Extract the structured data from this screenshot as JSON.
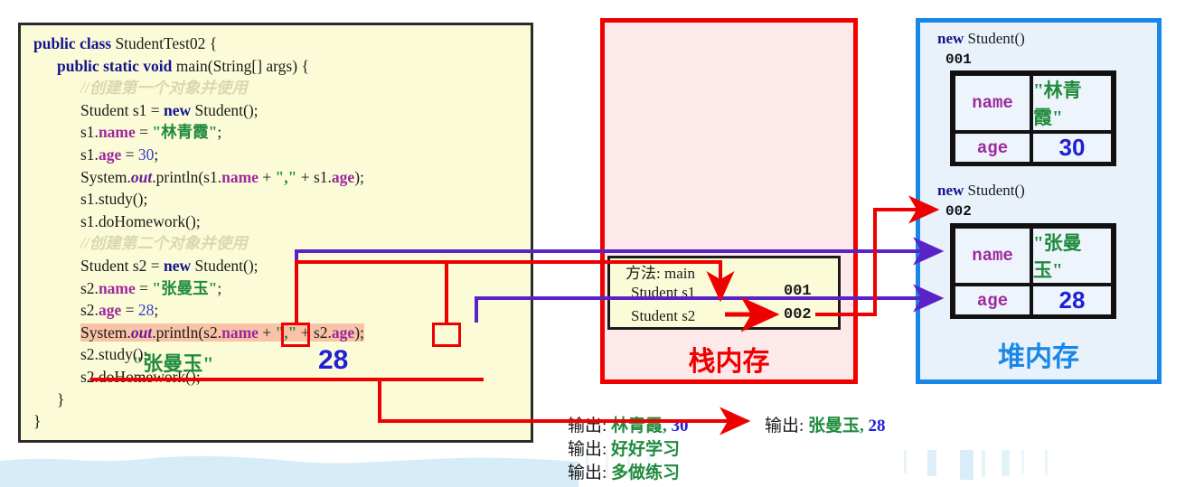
{
  "code": {
    "lines": [
      {
        "id": "line-1",
        "indent": 0,
        "segments": [
          {
            "t": "public class ",
            "c": "kw"
          },
          {
            "t": "StudentTest02 {",
            "c": ""
          }
        ]
      },
      {
        "id": "line-2",
        "indent": 1,
        "segments": [
          {
            "t": "public static void ",
            "c": "kw"
          },
          {
            "t": "main(String[] args) {",
            "c": ""
          }
        ]
      },
      {
        "id": "line-3",
        "indent": 2,
        "segments": [
          {
            "t": "//创建第一个对象并使用",
            "c": "cmt"
          }
        ]
      },
      {
        "id": "line-4",
        "indent": 2,
        "segments": [
          {
            "t": "Student s1 = ",
            "c": ""
          },
          {
            "t": "new ",
            "c": "kw"
          },
          {
            "t": "Student();",
            "c": ""
          }
        ]
      },
      {
        "id": "line-5",
        "indent": 2,
        "segments": [
          {
            "t": "s1.",
            "c": ""
          },
          {
            "t": "name",
            "c": "field"
          },
          {
            "t": " = ",
            "c": ""
          },
          {
            "t": "\"林青霞\"",
            "c": "str"
          },
          {
            "t": ";",
            "c": ""
          }
        ]
      },
      {
        "id": "line-6",
        "indent": 2,
        "segments": [
          {
            "t": "s1.",
            "c": ""
          },
          {
            "t": "age",
            "c": "field"
          },
          {
            "t": " = ",
            "c": ""
          },
          {
            "t": "30",
            "c": "num"
          },
          {
            "t": ";",
            "c": ""
          }
        ]
      },
      {
        "id": "line-7",
        "indent": 2,
        "segments": [
          {
            "t": "System.",
            "c": ""
          },
          {
            "t": "out",
            "c": "ital"
          },
          {
            "t": ".println(s1.",
            "c": ""
          },
          {
            "t": "name",
            "c": "field"
          },
          {
            "t": " + ",
            "c": ""
          },
          {
            "t": "\",\"",
            "c": "str"
          },
          {
            "t": " + s1.",
            "c": ""
          },
          {
            "t": "age",
            "c": "field"
          },
          {
            "t": ");",
            "c": ""
          }
        ]
      },
      {
        "id": "line-8",
        "indent": 2,
        "segments": [
          {
            "t": "s1.study();",
            "c": ""
          }
        ]
      },
      {
        "id": "line-9",
        "indent": 2,
        "segments": [
          {
            "t": "s1.doHomework();",
            "c": ""
          }
        ]
      },
      {
        "id": "line-10",
        "indent": 2,
        "segments": [
          {
            "t": "//创建第二个对象并使用",
            "c": "cmt"
          }
        ]
      },
      {
        "id": "line-11",
        "indent": 2,
        "segments": [
          {
            "t": "Student s2 = ",
            "c": ""
          },
          {
            "t": "new ",
            "c": "kw"
          },
          {
            "t": "Student();",
            "c": ""
          }
        ]
      },
      {
        "id": "line-12",
        "indent": 2,
        "segments": [
          {
            "t": "s2.",
            "c": ""
          },
          {
            "t": "name",
            "c": "field"
          },
          {
            "t": " = ",
            "c": ""
          },
          {
            "t": "\"张曼玉\"",
            "c": "str"
          },
          {
            "t": ";",
            "c": ""
          }
        ]
      },
      {
        "id": "line-13",
        "indent": 2,
        "segments": [
          {
            "t": "s2.",
            "c": ""
          },
          {
            "t": "age",
            "c": "field"
          },
          {
            "t": " = ",
            "c": ""
          },
          {
            "t": "28",
            "c": "num"
          },
          {
            "t": ";",
            "c": ""
          }
        ]
      },
      {
        "id": "line-14",
        "indent": 2,
        "highlight": true,
        "segments": [
          {
            "t": "System.",
            "c": ""
          },
          {
            "t": "out",
            "c": "ital"
          },
          {
            "t": ".println(s2.",
            "c": ""
          },
          {
            "t": "name",
            "c": "field"
          },
          {
            "t": " + ",
            "c": ""
          },
          {
            "t": "\",\"",
            "c": "str"
          },
          {
            "t": " + s2.",
            "c": ""
          },
          {
            "t": "age",
            "c": "field"
          },
          {
            "t": ");",
            "c": ""
          }
        ]
      },
      {
        "id": "line-15",
        "indent": 2,
        "segments": [
          {
            "t": "s2.study();",
            "c": ""
          }
        ]
      },
      {
        "id": "line-16",
        "indent": 2,
        "segments": [
          {
            "t": "s2.doHomework();",
            "c": ""
          }
        ]
      },
      {
        "id": "line-17",
        "indent": 1,
        "segments": [
          {
            "t": "}",
            "c": ""
          }
        ]
      },
      {
        "id": "line-18",
        "indent": 0,
        "segments": [
          {
            "t": "}",
            "c": ""
          }
        ]
      }
    ],
    "annotations": {
      "name_value": "\"张曼玉\"",
      "age_value": "28"
    }
  },
  "stack": {
    "title": "栈内存",
    "frame_label": "方法: main",
    "rows": [
      {
        "var": "Student s1",
        "address": "001"
      },
      {
        "var": "Student s2",
        "address": "002"
      }
    ]
  },
  "heap": {
    "title": "堆内存",
    "objects": [
      {
        "new_kw": "new",
        "new_rest": " Student()",
        "address": "001",
        "fields": [
          {
            "key": "name",
            "value": "\"林青霞\"",
            "kind": "str"
          },
          {
            "key": "age",
            "value": "30",
            "kind": "num"
          }
        ]
      },
      {
        "new_kw": "new",
        "new_rest": " Student()",
        "address": "002",
        "fields": [
          {
            "key": "name",
            "value": "\"张曼玉\"",
            "kind": "str"
          },
          {
            "key": "age",
            "value": "28",
            "kind": "num"
          }
        ]
      }
    ]
  },
  "console": {
    "lines": [
      {
        "id": "out-1",
        "label": "输出:",
        "name": "林青霞,",
        "num": "30"
      },
      {
        "id": "out-2",
        "label": "输出:",
        "name": "张曼玉,",
        "num": "28"
      },
      {
        "id": "out-3",
        "label": "输出:",
        "name": "好好学习",
        "num": ""
      },
      {
        "id": "out-4",
        "label": "输出:",
        "name": "多做练习",
        "num": ""
      }
    ]
  },
  "colors": {
    "stack_red": "#f00000",
    "heap_blue": "#1787e8",
    "code_bg": "#fbfbd8",
    "highlight": "#f8c3a6",
    "arrow_red": "#ee0000",
    "arrow_purple": "#5a23c8",
    "string_green": "#1f8b3c",
    "number_blue": "#1f1fd8",
    "field_purple": "#9c2a9c",
    "deco_blue": "#d6ecf7"
  }
}
